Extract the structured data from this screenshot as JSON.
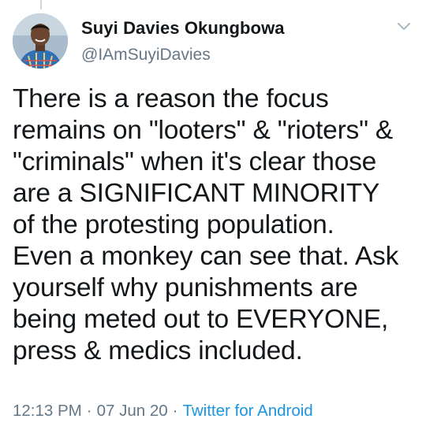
{
  "author": {
    "display_name": "Suyi Davies Okungbowa",
    "handle": "@IAmSuyiDavies"
  },
  "tweet": {
    "lines": [
      "There is a reason the focus",
      "remains on \"looters\" & \"rioters\" &",
      "\"criminals\" when it's clear those",
      "are a SIGNIFICANT MINORITY",
      "of the protesting population.",
      "Even a monkey can see that. Ask",
      "yourself why punishments are",
      "being meted out to EVERYONE,",
      "press & medics included."
    ]
  },
  "meta": {
    "time": "12:13 PM",
    "separator": "·",
    "date": "07 Jun 20",
    "source": "Twitter for Android"
  },
  "icons": {
    "menu": "chevron-down-icon",
    "avatar": "avatar"
  },
  "colors": {
    "text": "#14171a",
    "secondary": "#657786",
    "link": "#1b95e0",
    "thread_line": "#ccd6dd"
  }
}
